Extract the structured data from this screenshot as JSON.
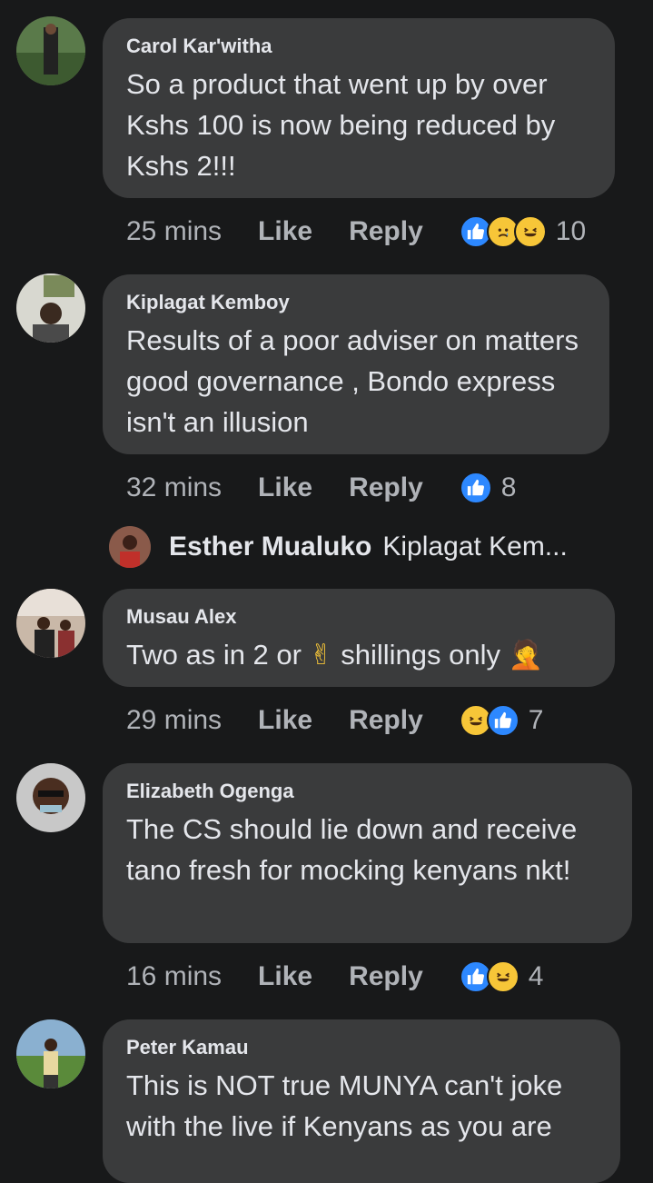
{
  "comments": [
    {
      "author": "Carol Kar'witha",
      "text": "So a product that went up by over Kshs 100 is now being reduced by Kshs 2!!!",
      "time": "25 mins",
      "like_label": "Like",
      "reply_label": "Reply",
      "reactions": [
        "like",
        "sad",
        "haha"
      ],
      "reaction_count": "10"
    },
    {
      "author": "Kiplagat Kemboy",
      "text": "Results of a poor adviser on matters good governance , Bondo express isn't an illusion",
      "time": "32 mins",
      "like_label": "Like",
      "reply_label": "Reply",
      "reactions": [
        "like"
      ],
      "reaction_count": "8",
      "reply_preview": {
        "name": "Esther Mualuko",
        "snippet": "Kiplagat Kem..."
      }
    },
    {
      "author": "Musau Alex",
      "text_before": "Two as in 2 or",
      "emoji_1": "✌",
      "text_after": "shillings only",
      "emoji_2": "🤦",
      "time": "29 mins",
      "like_label": "Like",
      "reply_label": "Reply",
      "reactions": [
        "haha",
        "like"
      ],
      "reaction_count": "7"
    },
    {
      "author": "Elizabeth Ogenga",
      "text": "The CS should lie down and receive tano fresh for mocking kenyans nkt!",
      "time": "16 mins",
      "like_label": "Like",
      "reply_label": "Reply",
      "reactions": [
        "like",
        "haha"
      ],
      "reaction_count": "4"
    },
    {
      "author": "Peter Kamau",
      "text": "This is NOT true MUNYA can't joke with the live if Kenyans as you are"
    }
  ],
  "colors": {
    "background": "#18191a",
    "bubble": "#3a3b3c",
    "like_blue": "#2d88ff",
    "emoji_yellow": "#f7c638"
  }
}
